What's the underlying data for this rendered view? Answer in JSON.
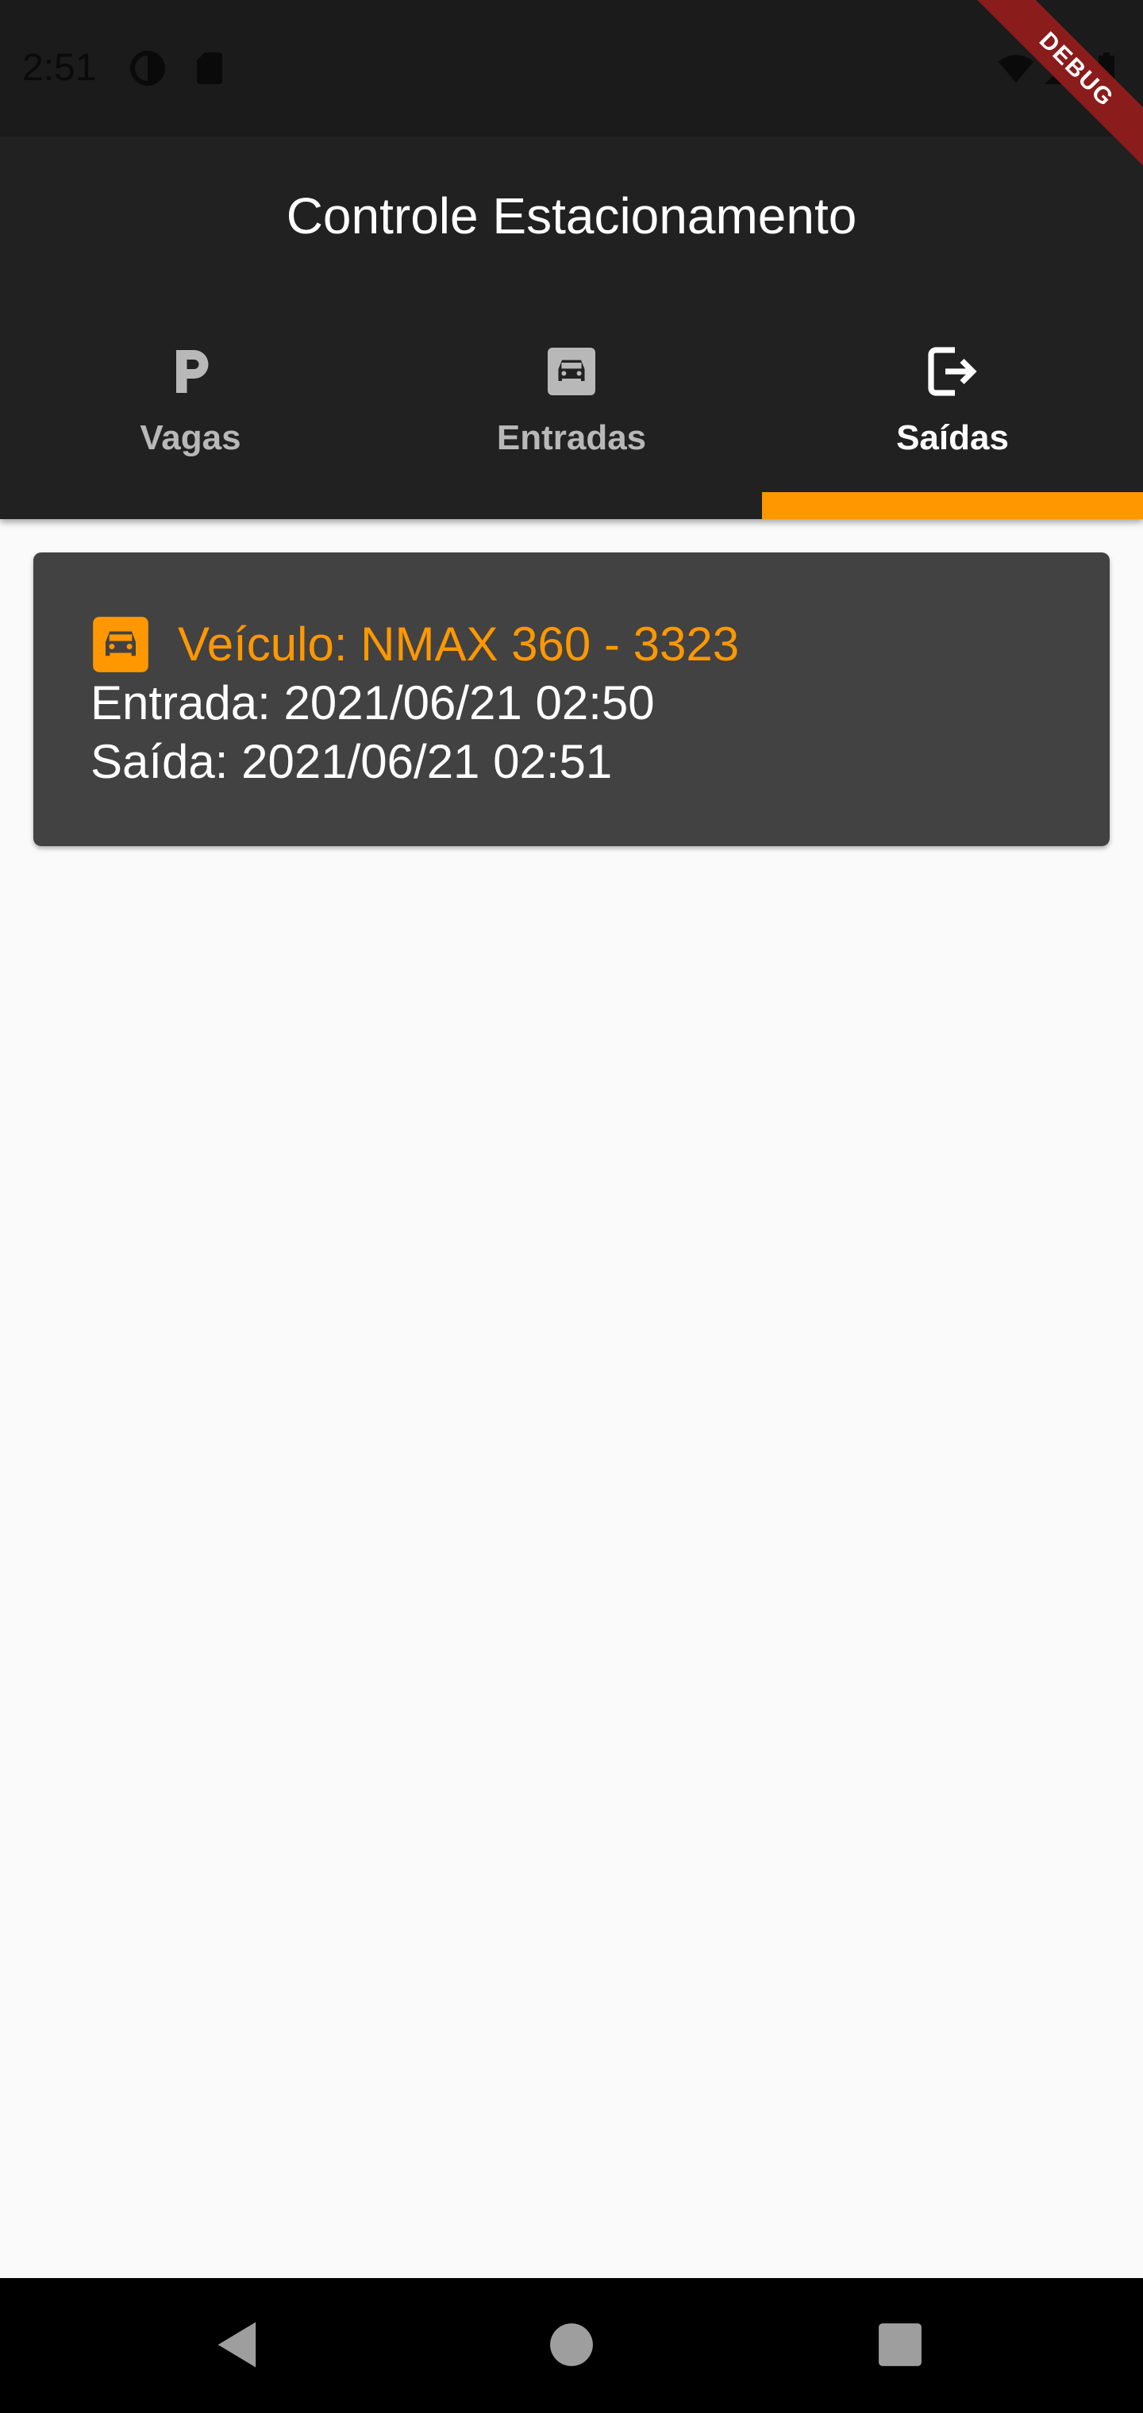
{
  "status_bar": {
    "time": "2:51",
    "icons": [
      "data-saver-icon",
      "sd-card-icon",
      "wifi-icon",
      "signal-icon",
      "battery-icon"
    ]
  },
  "debug_banner": "DEBUG",
  "app_bar": {
    "title": "Controle Estacionamento"
  },
  "tabs": [
    {
      "label": "Vagas",
      "icon": "parking-icon",
      "active": false
    },
    {
      "label": "Entradas",
      "icon": "car-icon",
      "active": false
    },
    {
      "label": "Saídas",
      "icon": "logout-icon",
      "active": true
    }
  ],
  "records": [
    {
      "icon": "car-icon",
      "vehicle": "Veículo: NMAX 360 - 3323",
      "entrada": "Entrada: 2021/06/21 02:50",
      "saida": "Saída: 2021/06/21 02:51"
    }
  ],
  "nav_bar": {
    "buttons": [
      "back-icon",
      "home-icon",
      "recents-icon"
    ]
  },
  "colors": {
    "accent": "#ff9800",
    "app_bar": "#212121",
    "card": "#424242",
    "background": "#fafafa",
    "debug_ribbon": "#8b1c1c"
  }
}
